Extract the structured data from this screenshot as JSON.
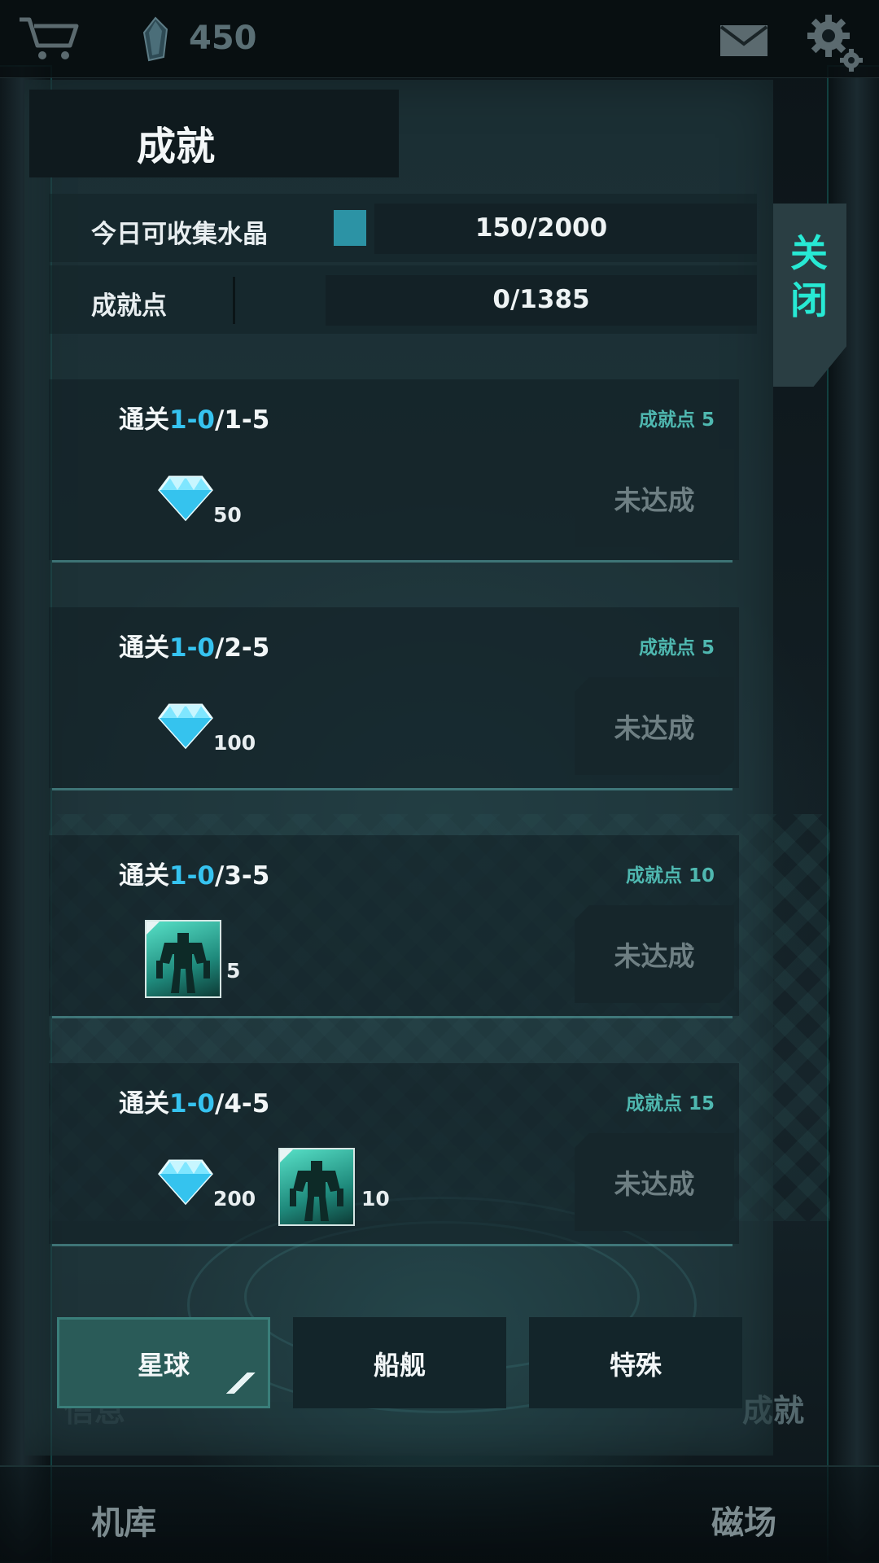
{
  "topbar": {
    "crystal_count": "450",
    "icons": [
      "cart-icon",
      "crystal-icon",
      "mail-icon",
      "gear-icon"
    ]
  },
  "panel": {
    "title": "成就",
    "close_label": "关闭",
    "stats": [
      {
        "label": "今日可收集水晶",
        "value": "150/2000"
      },
      {
        "label": "成就点",
        "value": "0/1385"
      }
    ]
  },
  "achievements": [
    {
      "title_prefix": "通关",
      "title_highlight": "1-0",
      "title_suffix": "/1-5",
      "points_label": "成就点",
      "points": "5",
      "rewards": [
        {
          "type": "diamond-icon",
          "count": "50"
        }
      ],
      "status": "未达成"
    },
    {
      "title_prefix": "通关",
      "title_highlight": "1-0",
      "title_suffix": "/2-5",
      "points_label": "成就点",
      "points": "5",
      "rewards": [
        {
          "type": "diamond-icon",
          "count": "100"
        }
      ],
      "status": "未达成"
    },
    {
      "title_prefix": "通关",
      "title_highlight": "1-0",
      "title_suffix": "/3-5",
      "points_label": "成就点",
      "points": "10",
      "rewards": [
        {
          "type": "mech-card-icon",
          "count": "5"
        }
      ],
      "status": "未达成"
    },
    {
      "title_prefix": "通关",
      "title_highlight": "1-0",
      "title_suffix": "/4-5",
      "points_label": "成就点",
      "points": "15",
      "rewards": [
        {
          "type": "diamond-icon",
          "count": "200"
        },
        {
          "type": "mech-card-icon",
          "count": "10"
        }
      ],
      "status": "未达成"
    }
  ],
  "categories": [
    {
      "label": "星球",
      "active": true
    },
    {
      "label": "船舰",
      "active": false
    },
    {
      "label": "特殊",
      "active": false
    }
  ],
  "background_labels": {
    "left_faded": "信息",
    "right": "成就"
  },
  "bottom_nav": [
    "机库",
    "磁场"
  ],
  "colors": {
    "accent_cyan": "#27e9d4",
    "highlight_blue": "#36c3f0",
    "points_teal": "#4fb8b0",
    "crystal_square": "#2c93a5"
  }
}
